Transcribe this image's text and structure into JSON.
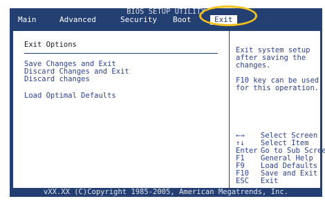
{
  "header": {
    "title": "BIOS SETUP UTILITY"
  },
  "tabs": [
    "Main",
    "Advanced",
    "Security",
    "Boot",
    "Exit"
  ],
  "left": {
    "section_title": "Exit Options",
    "items": [
      "Save Changes and Exit",
      "Discard Changes and Exit",
      "Discard changes",
      "Load Optimal Defaults"
    ]
  },
  "help": {
    "lines": [
      "Exit system setup",
      "after saving the",
      "changes.",
      "",
      "F10 key can be used",
      "for this operation."
    ]
  },
  "keys": [
    {
      "key": "←→",
      "desc": "Select Screen"
    },
    {
      "key": "↑↓",
      "desc": "Select Item"
    },
    {
      "key": "Enter",
      "desc": "Go to Sub Screen"
    },
    {
      "key": "F1",
      "desc": "General Help"
    },
    {
      "key": "F9",
      "desc": "Load Defaults"
    },
    {
      "key": "F10",
      "desc": "Save and Exit"
    },
    {
      "key": "ESC",
      "desc": "Exit"
    }
  ],
  "footer": {
    "text": "vXX.XX (C)Copyright 1985-2005, American Megatrends, Inc."
  },
  "colors": {
    "frame": "#243f72",
    "text_blue": "#2b3f8f",
    "highlight": "#f2c21a"
  }
}
